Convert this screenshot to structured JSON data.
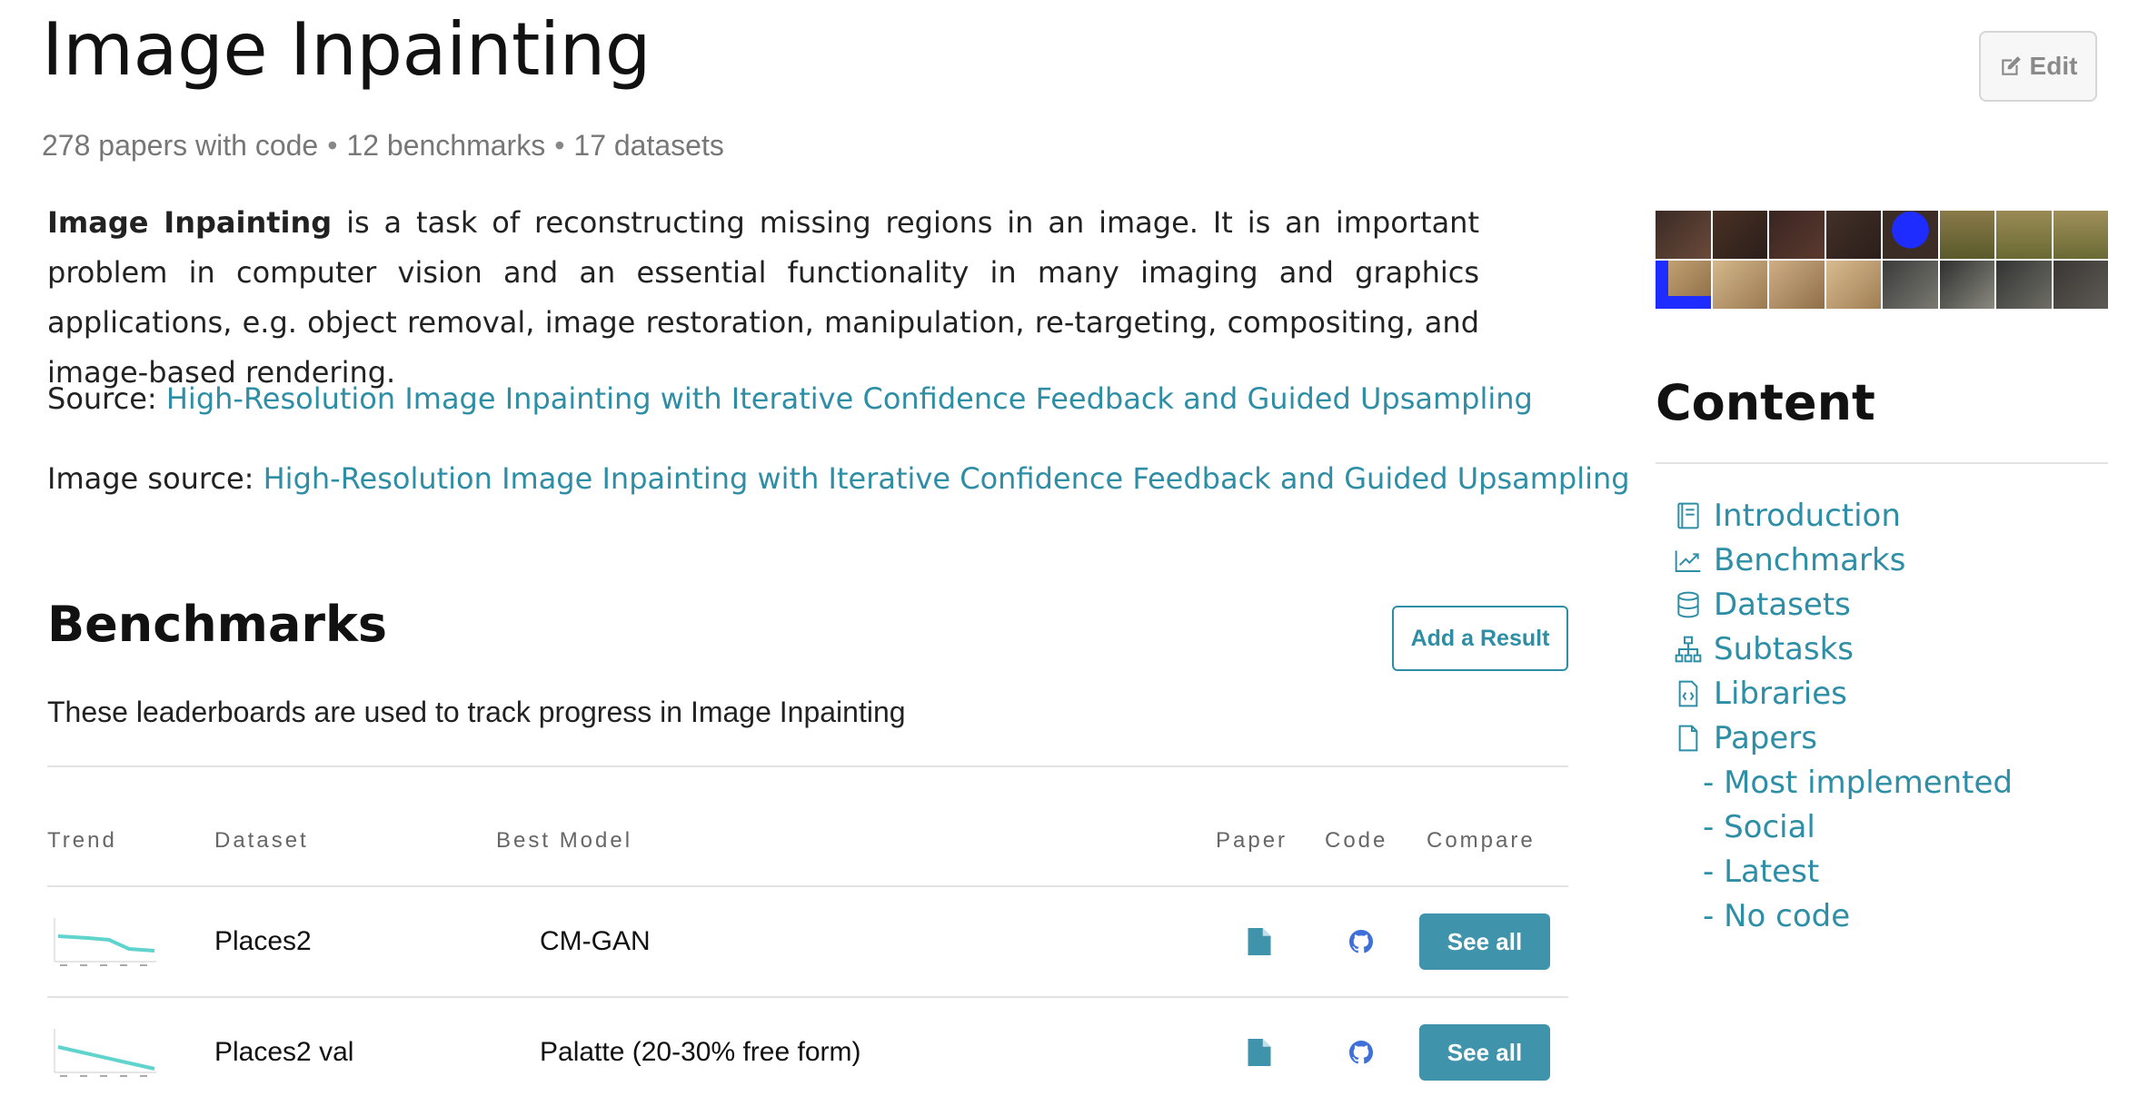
{
  "page": {
    "title": "Image Inpainting",
    "stats": [
      "278 papers with code",
      "12 benchmarks",
      "17 datasets"
    ],
    "stats_separator": "•",
    "edit_label": "Edit"
  },
  "description": {
    "bold": "Image Inpainting",
    "text": " is a task of reconstructing missing regions in an image. It is an important problem in computer vision and an essential functionality in many imaging and graphics applications, e.g. object removal, image restoration, manipulation, re-targeting, compositing, and image-based rendering."
  },
  "sources": {
    "source_label": "Source:",
    "source_link": "High-Resolution Image Inpainting with Iterative Confidence Feedback and Guided Upsampling",
    "image_source_label": "Image source:",
    "image_source_link": "High-Resolution Image Inpainting with Iterative Confidence Feedback and Guided Upsampling"
  },
  "sidebar": {
    "content_title": "Content",
    "items": [
      {
        "label": "Introduction",
        "icon": "book-icon"
      },
      {
        "label": "Benchmarks",
        "icon": "trend-chart-icon"
      },
      {
        "label": "Datasets",
        "icon": "database-icon"
      },
      {
        "label": "Subtasks",
        "icon": "sitemap-icon"
      },
      {
        "label": "Libraries",
        "icon": "code-file-icon"
      },
      {
        "label": "Papers",
        "icon": "file-icon"
      }
    ],
    "sub_items": [
      "- Most implemented",
      "- Social",
      "- Latest",
      "- No code"
    ]
  },
  "benchmarks": {
    "title": "Benchmarks",
    "add_result_label": "Add a Result",
    "subtitle": "These leaderboards are used to track progress in Image Inpainting",
    "columns": [
      "Trend",
      "Dataset",
      "Best Model",
      "Paper",
      "Code",
      "Compare"
    ],
    "rows": [
      {
        "dataset": "Places2",
        "best_model": "CM-GAN",
        "compare_label": "See all"
      },
      {
        "dataset": "Places2 val",
        "best_model": "Palatte (20-30% free form)",
        "compare_label": "See all"
      }
    ]
  },
  "colors": {
    "link": "#2e8ea6",
    "button": "#3f93ab",
    "trend_line": "#5fd3cc"
  }
}
